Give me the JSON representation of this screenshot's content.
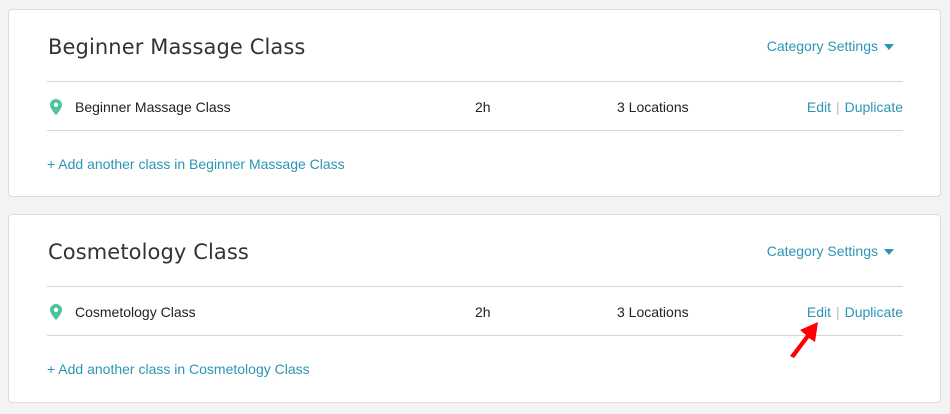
{
  "categories": [
    {
      "title": "Beginner Massage Class",
      "settings_label": "Category Settings",
      "classes": [
        {
          "name": "Beginner Massage Class",
          "duration": "2h",
          "locations": "3 Locations",
          "edit_label": "Edit",
          "duplicate_label": "Duplicate"
        }
      ],
      "add_label": "+ Add another class in Beginner Massage Class"
    },
    {
      "title": "Cosmetology Class",
      "settings_label": "Category Settings",
      "classes": [
        {
          "name": "Cosmetology Class",
          "duration": "2h",
          "locations": "3 Locations",
          "edit_label": "Edit",
          "duplicate_label": "Duplicate"
        }
      ],
      "add_label": "+ Add another class in Cosmetology Class"
    }
  ],
  "icons": {
    "location": "map-pin-icon",
    "annotation": "red-arrow-icon"
  },
  "colors": {
    "accent": "#2b95b6",
    "pin": "#4cc49a",
    "annotation": "#ff0000"
  }
}
